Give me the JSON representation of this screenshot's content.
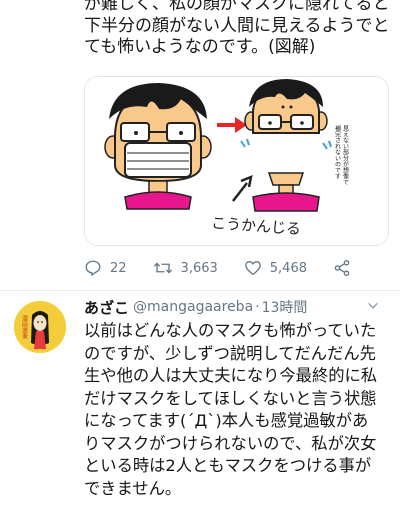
{
  "tweet": {
    "lines": [
      "が難しく、私の顔がマスクに隠れてると",
      "下半分の顔がない人間に見えるようでと",
      "ても怖いようなのです。(図解)"
    ],
    "illustration": {
      "caption_vertical": [
        "見えない部分が想像で",
        "補完されないのです"
      ],
      "handwritten": "こうかんじる"
    },
    "actions": {
      "reply_count": "22",
      "retweet_count": "3,663",
      "like_count": "5,468"
    }
  },
  "reply": {
    "name": "あざこ",
    "handle": "@mangagaareba",
    "separator": "·",
    "time": "13時間",
    "avatar_text": "漫画道楽",
    "lines": [
      "以前はどんな人のマスクも怖がっていた",
      "のですが、少しずつ説明してだんだん先",
      "生や他の人は大丈夫になり今最終的に私",
      "だけマスクをしてほしくないと言う状態",
      "になってます(´Д`)本人も感覚過敏があ",
      "りマスクがつけられないので、私が次女",
      "といる時は2人ともマスクをつける事が",
      "できません。"
    ]
  },
  "colors": {
    "text": "#14171a",
    "secondary": "#657786",
    "divider": "#e6ecf0",
    "mask_accent": "#e8168c",
    "arrow_red": "#e8262a",
    "skin": "#f9c88b"
  },
  "icons": [
    "reply-icon",
    "retweet-icon",
    "like-icon",
    "share-icon",
    "chevron-down-icon"
  ]
}
